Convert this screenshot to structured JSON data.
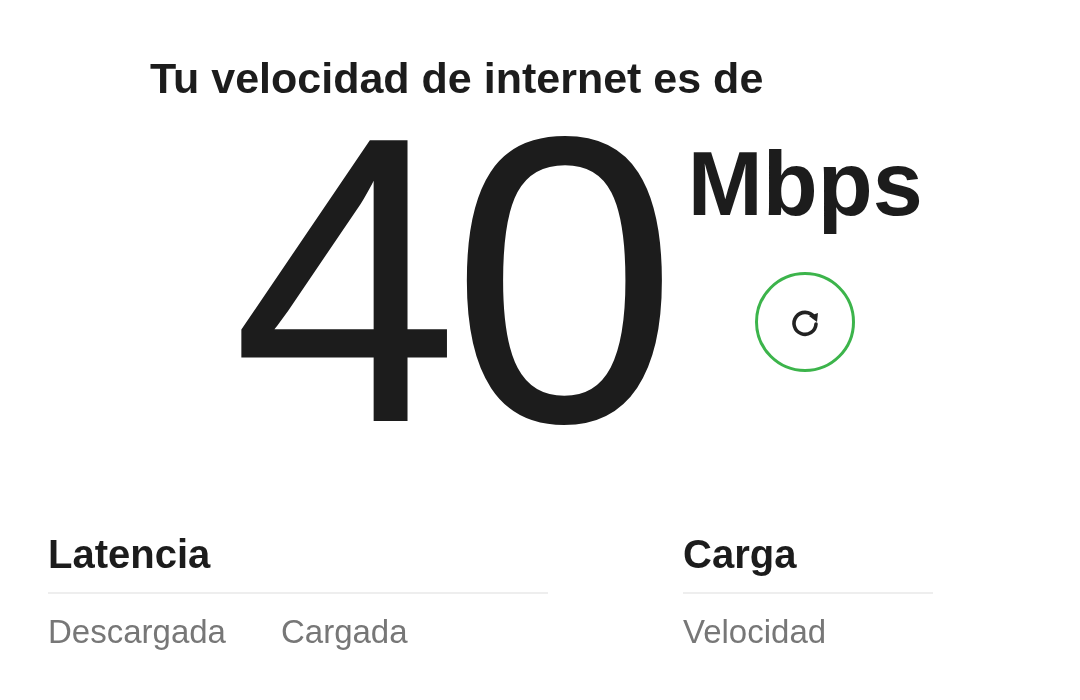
{
  "title": "Tu velocidad de internet es de",
  "speed": {
    "value": "40",
    "unit": "Mbps"
  },
  "sections": [
    {
      "heading": "Latencia",
      "labels": [
        "Descargada",
        "Cargada"
      ]
    },
    {
      "heading": "Carga",
      "labels": [
        "Velocidad"
      ]
    }
  ]
}
